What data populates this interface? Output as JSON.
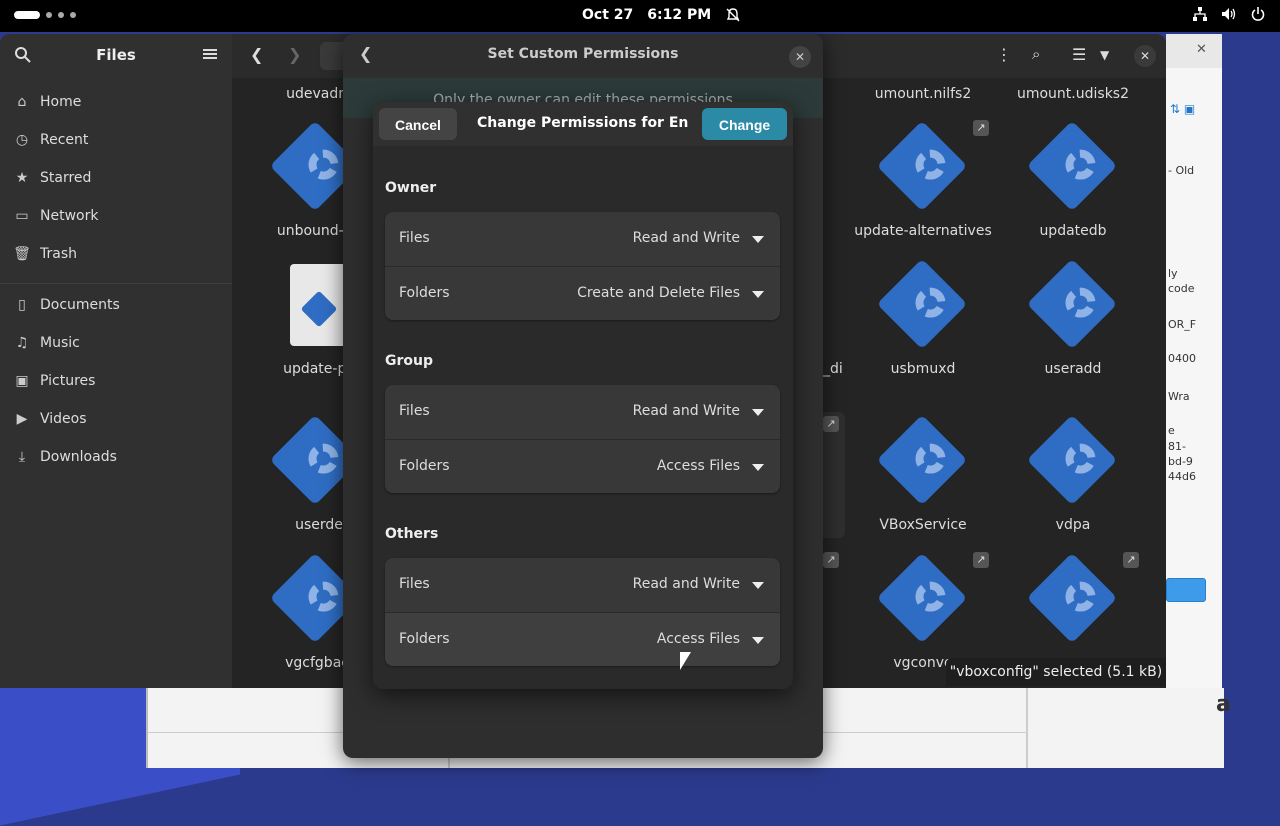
{
  "topbar": {
    "date": "Oct 27",
    "time": "6:12 PM"
  },
  "sidebar": {
    "title": "Files",
    "items": [
      {
        "label": "Home",
        "icon": "home-icon"
      },
      {
        "label": "Recent",
        "icon": "clock-icon"
      },
      {
        "label": "Starred",
        "icon": "star-icon"
      },
      {
        "label": "Network",
        "icon": "network-icon"
      },
      {
        "label": "Trash",
        "icon": "trash-icon"
      },
      {
        "label": "Documents",
        "icon": "document-icon"
      },
      {
        "label": "Music",
        "icon": "music-icon"
      },
      {
        "label": "Pictures",
        "icon": "picture-icon"
      },
      {
        "label": "Videos",
        "icon": "video-icon"
      },
      {
        "label": "Downloads",
        "icon": "download-icon"
      }
    ]
  },
  "files": {
    "left_col": [
      "udevadm",
      "unbound-an",
      "update-po",
      "userde",
      "vgcfgbacl"
    ],
    "right_col_a": [
      "umount.nilfs2",
      "update-alternatives",
      "usbmuxd",
      "VBoxService",
      "vgconve"
    ],
    "right_col_b": [
      "umount.udisks2",
      "updatedb",
      "useradd",
      "vdpa",
      ""
    ],
    "mid_fragment": "_di",
    "status": "\"vboxconfig\" selected  (5.1 kB)"
  },
  "props_dialog": {
    "title": "Set Custom Permissions",
    "banner": "Only the owner can edit these permissions"
  },
  "perm_sheet": {
    "cancel_label": "Cancel",
    "title": "Change Permissions for Encl…",
    "change_label": "Change",
    "sections": [
      {
        "title": "Owner",
        "files_label": "Files",
        "files_value": "Read and Write",
        "folders_label": "Folders",
        "folders_value": "Create and Delete Files"
      },
      {
        "title": "Group",
        "files_label": "Files",
        "files_value": "Read and Write",
        "folders_label": "Folders",
        "folders_value": "Access Files"
      },
      {
        "title": "Others",
        "files_label": "Files",
        "files_value": "Read and Write",
        "folders_label": "Folders",
        "folders_value": "Access Files"
      }
    ]
  },
  "side_window": {
    "lines": [
      "- Old",
      "ly",
      "code",
      "OR_F",
      "0400",
      "Wra",
      "e",
      "81-",
      "bd-9",
      "44d6"
    ]
  },
  "bg_window": {
    "letter": "a"
  },
  "colors": {
    "accent": "#2b8aa5",
    "window_bg": "#242424",
    "sidebar_bg": "#303030",
    "icon_blue": "#2f6dc4"
  }
}
